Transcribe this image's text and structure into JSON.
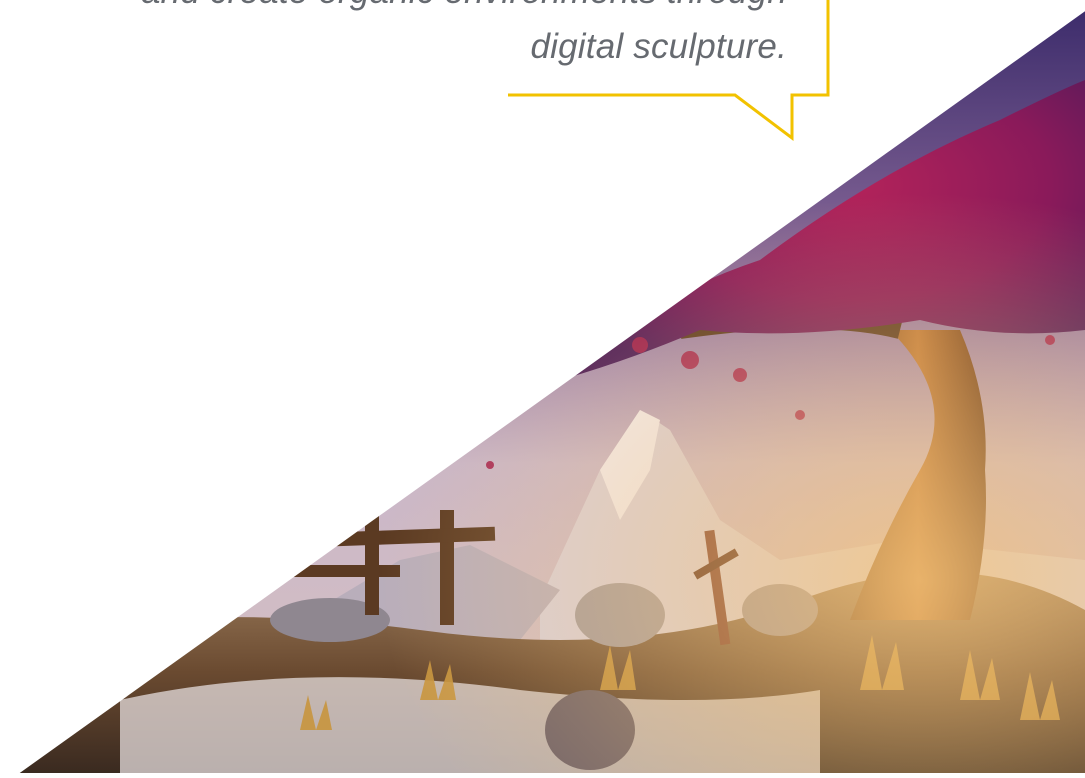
{
  "quote": {
    "line1": "and create organic environments through",
    "line2": "digital sculpture."
  },
  "colors": {
    "accent": "#f2c200",
    "quote_text": "#666a70"
  },
  "scene_image": {
    "icon": "scene-landscape-image"
  }
}
